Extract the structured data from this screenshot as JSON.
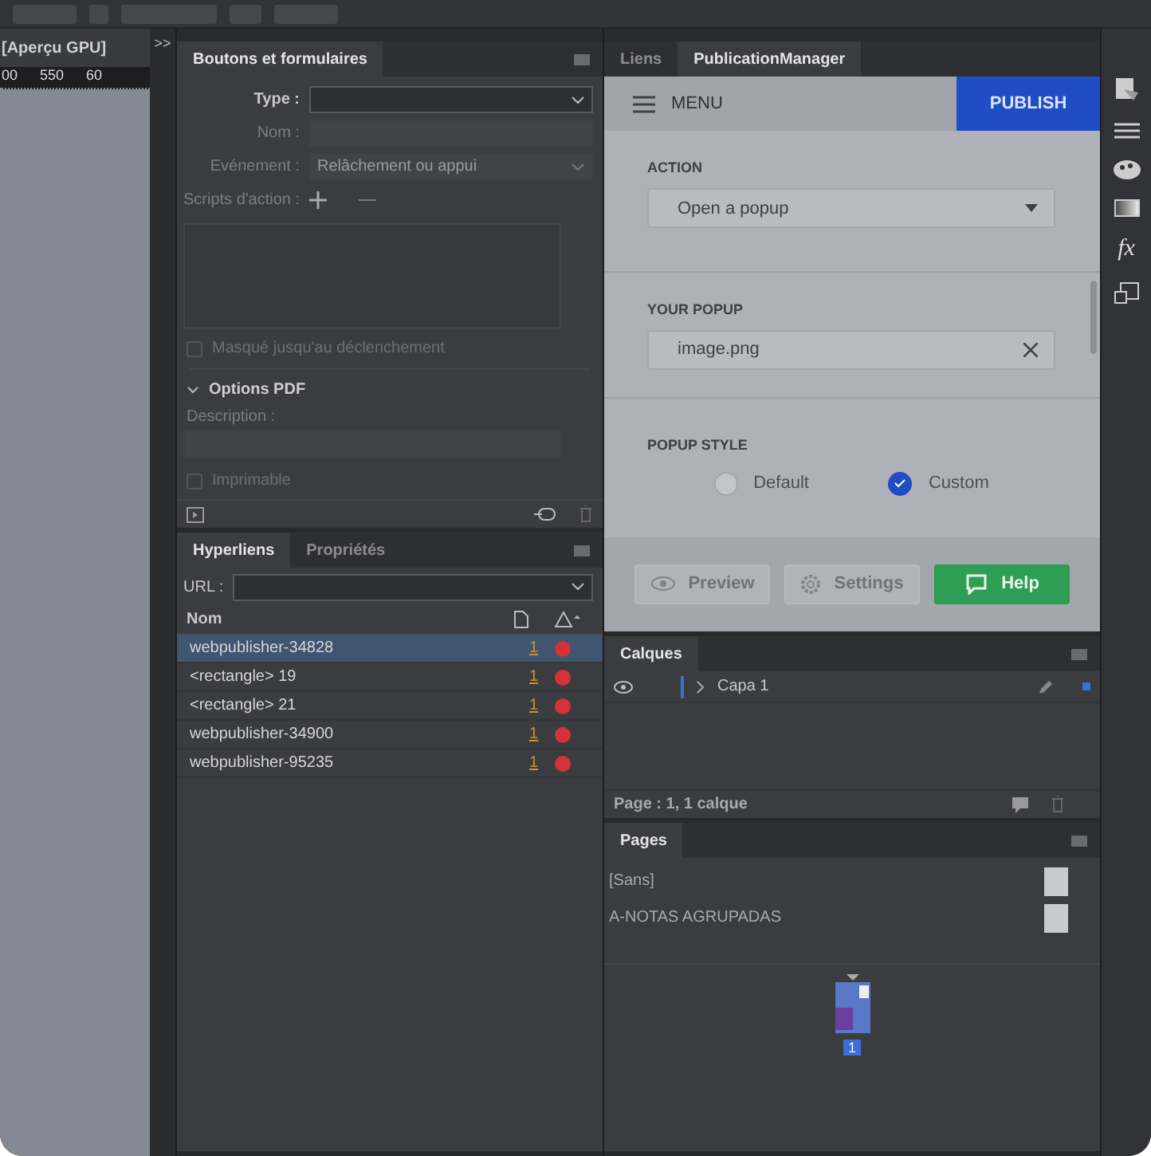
{
  "document": {
    "tab": "[Aperçu GPU]",
    "collapse": ">>",
    "ruler": [
      "00",
      "550",
      "60"
    ]
  },
  "buttons_panel": {
    "title": "Boutons et formulaires",
    "fields": [
      {
        "label": "Type :",
        "kind": "select",
        "disabled": false
      },
      {
        "label": "Nom :",
        "kind": "text",
        "disabled": true
      },
      {
        "label": "Evénement :",
        "kind": "select",
        "value": "Relâchement ou appui",
        "disabled": true
      }
    ],
    "scripts_label": "Scripts d'action :",
    "hidden": {
      "label": "Masqué jusqu'au déclenchement",
      "checked": false
    },
    "pdf_options": {
      "title": "Options PDF",
      "expanded": true,
      "description_label": "Description :",
      "printable": {
        "label": "Imprimable",
        "checked": false
      }
    }
  },
  "hyperlinks_panel": {
    "tabs": [
      {
        "label": "Hyperliens",
        "selected": true
      },
      {
        "label": "Propriétés",
        "selected": false
      }
    ],
    "url_label": "URL :",
    "column": "Nom",
    "rows": [
      {
        "name": "webpublisher-34828",
        "page": "1",
        "selected": true,
        "color": "#d3323a"
      },
      {
        "name": "<rectangle> 19",
        "page": "1",
        "selected": false,
        "color": "#d3323a"
      },
      {
        "name": "<rectangle> 21",
        "page": "1",
        "selected": false,
        "color": "#d3323a"
      },
      {
        "name": "webpublisher-34900",
        "page": "1",
        "selected": false,
        "color": "#d3323a"
      },
      {
        "name": "webpublisher-95235",
        "page": "1",
        "selected": false,
        "color": "#d3323a"
      }
    ]
  },
  "right_tabs": [
    {
      "label": "Liens",
      "selected": false
    },
    {
      "label": "PublicationManager",
      "selected": true
    }
  ],
  "plugin": {
    "menu": "MENU",
    "publish": "PUBLISH",
    "action_label": "ACTION",
    "action_value": "Open a popup",
    "popup_label": "YOUR POPUP",
    "popup_value": "image.png",
    "style_label": "POPUP STYLE",
    "styles": [
      {
        "label": "Default",
        "selected": false
      },
      {
        "label": "Custom",
        "selected": true
      }
    ],
    "buttons": [
      {
        "label": "Preview",
        "kind": "preview",
        "disabled": true
      },
      {
        "label": "Settings",
        "kind": "settings",
        "disabled": true
      },
      {
        "label": "Help",
        "kind": "help",
        "disabled": false
      }
    ]
  },
  "layers_panel": {
    "title": "Calques",
    "layers": [
      {
        "name": "Capa 1",
        "color": "#3a6fd8"
      }
    ],
    "status": "Page : 1, 1 calque"
  },
  "pages_panel": {
    "title": "Pages",
    "masters": [
      "[Sans]",
      "A-NOTAS AGRUPADAS"
    ],
    "page_number": "1"
  },
  "tool_strip": {
    "effects": "fx"
  }
}
